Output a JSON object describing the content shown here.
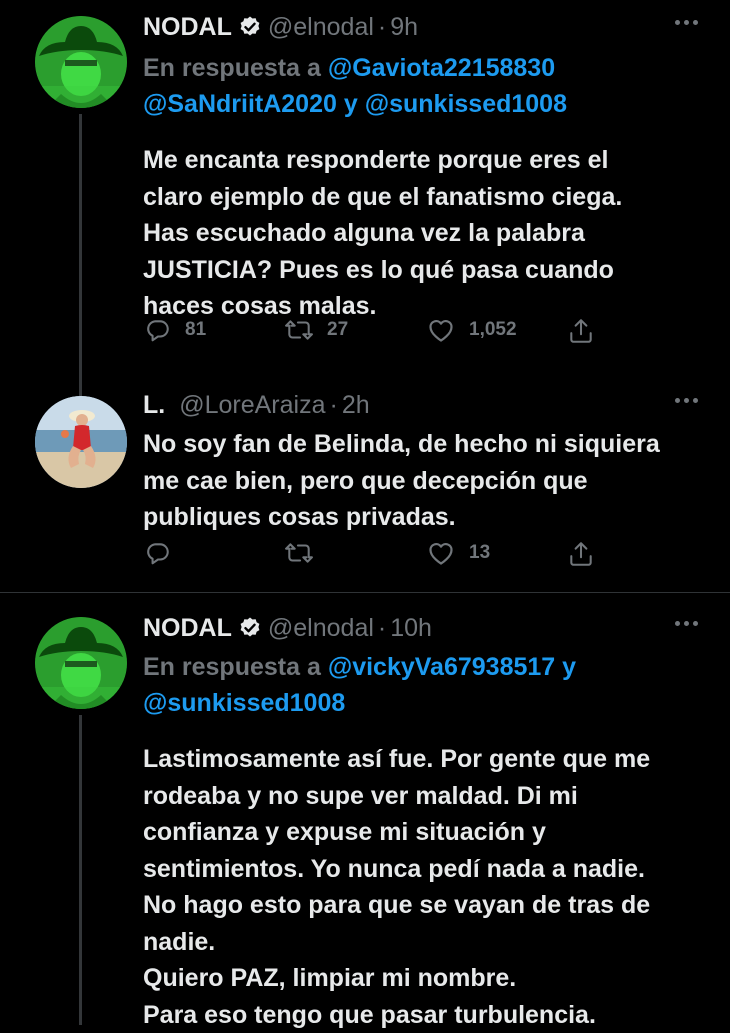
{
  "tweets": [
    {
      "name": "NODAL",
      "verified": true,
      "handle": "@elnodal",
      "dot": "·",
      "time": "9h",
      "reply_prefix": "En respuesta a",
      "reply_line1_mention": "@Gaviota22158830",
      "reply_line2_mention_a": "@SaNdriitA2020",
      "reply_line2_y": "y",
      "reply_line2_mention_b": "@sunkissed1008",
      "text": "Me encanta responderte porque eres el\nclaro ejemplo de que el fanatismo ciega.\nHas escuchado alguna vez la palabra\nJUSTICIA? Pues es lo qué pasa cuando\nhaces cosas malas.",
      "replies": "81",
      "retweets": "27",
      "likes": "1,052"
    },
    {
      "name": "L.",
      "verified": false,
      "handle": "@LoreAraiza",
      "dot": "·",
      "time": "2h",
      "text": "No soy fan de Belinda, de hecho ni siquiera\nme cae bien, pero que decepción que\npubliques cosas privadas.",
      "replies": "",
      "retweets": "",
      "likes": "13"
    },
    {
      "name": "NODAL",
      "verified": true,
      "handle": "@elnodal",
      "dot": "·",
      "time": "10h",
      "reply_prefix": "En respuesta a",
      "reply_line1_mention": "@vickyVa67938517",
      "reply_line1_y": "y",
      "reply_line2_mention": "@sunkissed1008",
      "text": "Lastimosamente así fue. Por gente que me\nrodeaba y no supe ver maldad. Di mi\nconfianza y expuse mi situación y\nsentimientos. Yo nunca pedí nada a nadie.\nNo hago esto para que se vayan de tras de\nnadie.\nQuiero PAZ, limpiar mi nombre.\nPara eso tengo que pasar turbulencia."
    }
  ],
  "colors": {
    "background": "#000000",
    "text": "#e7e9ea",
    "secondary": "#71767b",
    "link": "#1d9bf0",
    "avatar_green": "#2fcc33"
  },
  "icons": [
    "reply-icon",
    "retweet-icon",
    "like-icon",
    "share-icon",
    "verified-badge-icon",
    "more-icon"
  ]
}
